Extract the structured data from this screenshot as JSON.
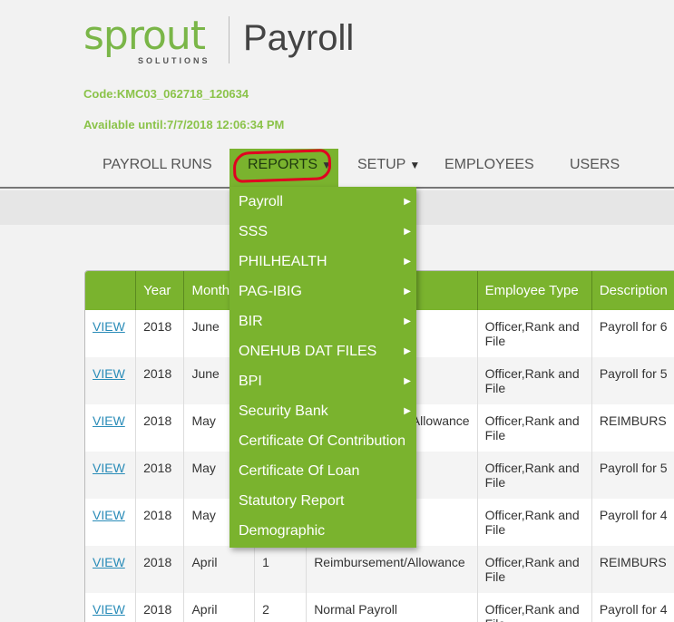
{
  "brand": {
    "logo_word": "sprout",
    "logo_sub": "SOLUTIONS",
    "app_title": "Payroll"
  },
  "session": {
    "code": "Code:KMC03_062718_120634",
    "available_until": "Available until:7/7/2018 12:06:34 PM"
  },
  "nav": {
    "items": [
      {
        "label": "PAYROLL RUNS"
      },
      {
        "label": "REPORTS",
        "arrow": "▼"
      },
      {
        "label": "SETUP",
        "arrow": "▼"
      },
      {
        "label": "EMPLOYEES"
      },
      {
        "label": "USERS"
      }
    ]
  },
  "reports_menu": {
    "items": [
      {
        "label": "Payroll",
        "submenu_arrow": "▶"
      },
      {
        "label": "SSS",
        "submenu_arrow": "▶"
      },
      {
        "label": "PHILHEALTH",
        "submenu_arrow": "▶"
      },
      {
        "label": "PAG-IBIG",
        "submenu_arrow": "▶"
      },
      {
        "label": "BIR",
        "submenu_arrow": "▶"
      },
      {
        "label": "ONEHUB DAT FILES",
        "submenu_arrow": "▶"
      },
      {
        "label": "BPI",
        "submenu_arrow": "▶"
      },
      {
        "label": "Security Bank",
        "submenu_arrow": "▶"
      },
      {
        "label": "Certificate Of Contribution"
      },
      {
        "label": "Certificate Of Loan"
      },
      {
        "label": "Statutory Report"
      },
      {
        "label": "Demographic"
      }
    ]
  },
  "table": {
    "headers": [
      "",
      "Year",
      "Month",
      "",
      "",
      "Employee Type",
      "Description"
    ],
    "rows": [
      [
        "VIEW",
        "2018",
        "June",
        "",
        "",
        "Officer,Rank and File",
        "Payroll for 6"
      ],
      [
        "VIEW",
        "2018",
        "June",
        "",
        "",
        "Officer,Rank and File",
        "Payroll for 5"
      ],
      [
        "VIEW",
        "2018",
        "May",
        "",
        "t/Allowance",
        "Officer,Rank and File",
        "REIMBURS"
      ],
      [
        "VIEW",
        "2018",
        "May",
        "",
        "",
        "Officer,Rank and File",
        "Payroll for 5"
      ],
      [
        "VIEW",
        "2018",
        "May",
        "",
        "",
        "Officer,Rank and File",
        "Payroll for 4"
      ],
      [
        "VIEW",
        "2018",
        "April",
        "1",
        "Reimbursement/Allowance",
        "Officer,Rank and File",
        "REIMBURS"
      ],
      [
        "VIEW",
        "2018",
        "April",
        "2",
        "Normal Payroll",
        "Officer,Rank and File",
        "Payroll for 4"
      ]
    ]
  },
  "colors": {
    "brand_green": "#7ab32e",
    "highlight_red": "#e00020",
    "link_blue": "#2a8cb8"
  }
}
